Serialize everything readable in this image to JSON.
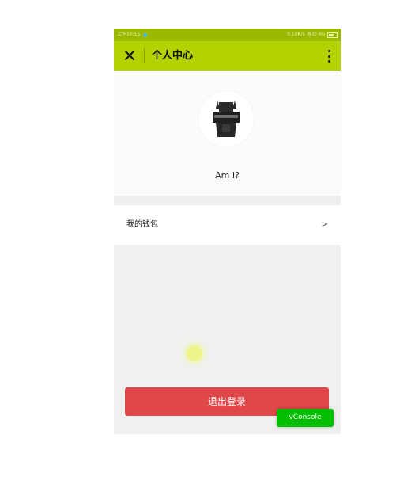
{
  "status_bar": {
    "time": "上午10:15",
    "network_speed": "0.10K/s",
    "carrier": "移动 4G"
  },
  "app_bar": {
    "close_icon": "close-icon",
    "title": "个人中心",
    "more_icon": "more-vertical-icon"
  },
  "profile": {
    "avatar_icon": "avatar-image",
    "name": "Am I?"
  },
  "menu": {
    "wallet_label": "我的钱包",
    "wallet_arrow": ">"
  },
  "actions": {
    "logout_label": "退出登录"
  },
  "vconsole": {
    "label": "vConsole"
  },
  "colors": {
    "status_bar": "#9bb800",
    "app_bar": "#b3d200",
    "logout": "#e0474a",
    "vconsole": "#04be02"
  }
}
